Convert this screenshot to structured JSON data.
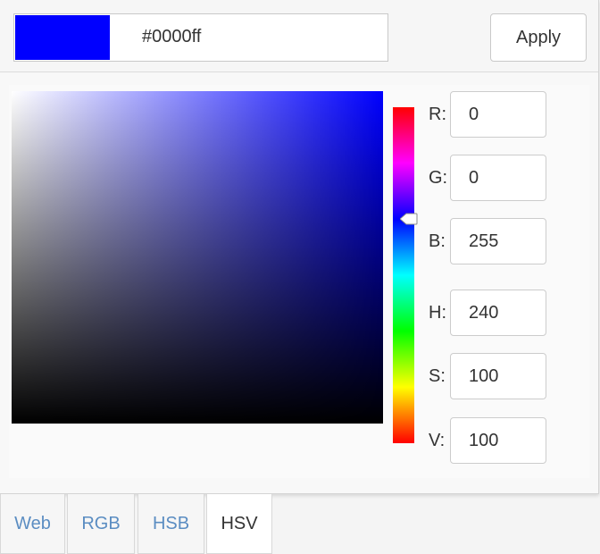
{
  "colors": {
    "current": "#0000ff",
    "hue_base": "#0000ff"
  },
  "header": {
    "hex_value": "#0000ff",
    "apply_label": "Apply"
  },
  "picker": {
    "hue_slider_level_degrees": 240
  },
  "fields": [
    {
      "label": "R:",
      "value": "0"
    },
    {
      "label": "G:",
      "value": "0"
    },
    {
      "label": "B:",
      "value": "255"
    },
    {
      "label": "H:",
      "value": "240"
    },
    {
      "label": "S:",
      "value": "100"
    },
    {
      "label": "V:",
      "value": "100"
    }
  ],
  "tabs": [
    {
      "label": "Web",
      "active": false
    },
    {
      "label": "RGB",
      "active": false
    },
    {
      "label": "HSB",
      "active": false
    },
    {
      "label": "HSV",
      "active": true
    }
  ]
}
